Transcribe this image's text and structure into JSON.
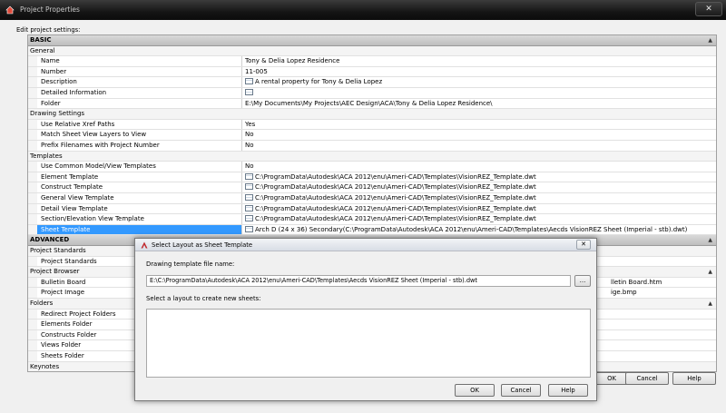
{
  "window": {
    "title": "Project Properties",
    "close_label": "✕"
  },
  "edit_label": "Edit project settings:",
  "sections": {
    "basic": "BASIC",
    "general": "General",
    "drawing_settings": "Drawing Settings",
    "templates": "Templates",
    "advanced": "ADVANCED",
    "project_standards": "Project Standards",
    "project_browser": "Project Browser",
    "folders": "Folders",
    "keynotes": "Keynotes"
  },
  "general": [
    {
      "name": "Name",
      "value": "Tony & Delia Lopez Residence"
    },
    {
      "name": "Number",
      "value": "11-005"
    },
    {
      "name": "Description",
      "value": "A rental property for Tony & Delia Lopez"
    },
    {
      "name": "Detailed Information",
      "value": ""
    },
    {
      "name": "Folder",
      "value": "E:\\My Documents\\My Projects\\AEC Design\\ACA\\Tony & Delia Lopez Residence\\"
    }
  ],
  "drawing_settings": [
    {
      "name": "Use Relative Xref Paths",
      "value": "Yes"
    },
    {
      "name": "Match Sheet View Layers to View",
      "value": "No"
    },
    {
      "name": "Prefix Filenames with Project Number",
      "value": "No"
    }
  ],
  "templates": [
    {
      "name": "Use Common Model/View Templates",
      "value": "No"
    },
    {
      "name": "Element Template",
      "value": "C:\\ProgramData\\Autodesk\\ACA 2012\\enu\\Ameri-CAD\\Templates\\VisionREZ_Template.dwt"
    },
    {
      "name": "Construct Template",
      "value": "C:\\ProgramData\\Autodesk\\ACA 2012\\enu\\Ameri-CAD\\Templates\\VisionREZ_Template.dwt"
    },
    {
      "name": "General View Template",
      "value": "C:\\ProgramData\\Autodesk\\ACA 2012\\enu\\Ameri-CAD\\Templates\\VisionREZ_Template.dwt"
    },
    {
      "name": "Detail View Template",
      "value": "C:\\ProgramData\\Autodesk\\ACA 2012\\enu\\Ameri-CAD\\Templates\\VisionREZ_Template.dwt"
    },
    {
      "name": "Section/Elevation View Template",
      "value": "C:\\ProgramData\\Autodesk\\ACA 2012\\enu\\Ameri-CAD\\Templates\\VisionREZ_Template.dwt"
    },
    {
      "name": "Sheet Template",
      "value": "Arch D (24 x 36) Secondary(C:\\ProgramData\\Autodesk\\ACA 2012\\enu\\Ameri-CAD\\Templates\\Aecds VisionREZ Sheet (Imperial - stb).dwt)"
    }
  ],
  "project_standards_items": [
    {
      "name": "Project Standards",
      "value": ""
    }
  ],
  "project_browser_items": [
    {
      "name": "Bulletin Board",
      "value": "lletin Board.htm"
    },
    {
      "name": "Project Image",
      "value": "ige.bmp"
    }
  ],
  "folders_items": [
    {
      "name": "Redirect Project Folders",
      "value": ""
    },
    {
      "name": "Elements Folder",
      "value": ""
    },
    {
      "name": "Constructs Folder",
      "value": ""
    },
    {
      "name": "Views Folder",
      "value": ""
    },
    {
      "name": "Sheets Folder",
      "value": ""
    }
  ],
  "main_buttons": {
    "ok": "OK",
    "cancel": "Cancel",
    "help": "Help"
  },
  "dialog": {
    "title": "Select Layout as Sheet Template",
    "close_label": "✕",
    "file_label": "Drawing template file name:",
    "file_value": "E:\\C:\\ProgramData\\Autodesk\\ACA 2012\\enu\\Ameri-CAD\\Templates\\Aecds VisionREZ Sheet (Imperial - stb).dwt",
    "browse_label": "...",
    "layout_label": "Select a layout to create new sheets:",
    "ok": "OK",
    "cancel": "Cancel",
    "help": "Help"
  },
  "colors": {
    "selection": "#3399ff",
    "titlebar": "#151515"
  }
}
